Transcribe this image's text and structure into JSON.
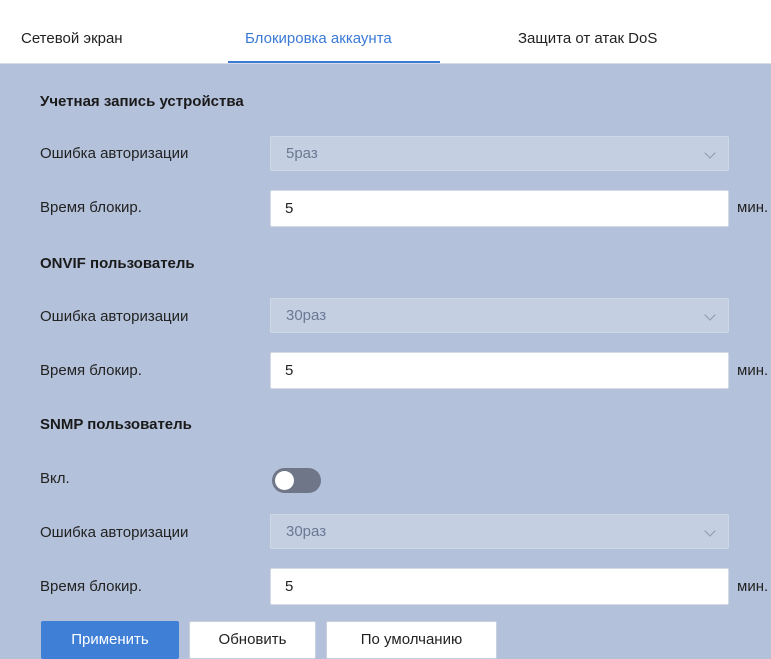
{
  "tabs": [
    {
      "label": "Сетевой экран",
      "active": false
    },
    {
      "label": "Блокировка аккаунта",
      "active": true
    },
    {
      "label": "Защита от атак DoS",
      "active": false
    }
  ],
  "device_account": {
    "title": "Учетная запись устройства",
    "auth_error_label": "Ошибка авторизации",
    "auth_error_value": "5раз",
    "lock_time_label": "Время блокир.",
    "lock_time_value": "5",
    "unit": "мин."
  },
  "onvif_user": {
    "title": "ONVIF пользователь",
    "auth_error_label": "Ошибка авторизации",
    "auth_error_value": "30раз",
    "lock_time_label": "Время блокир.",
    "lock_time_value": "5",
    "unit": "мин."
  },
  "snmp_user": {
    "title": "SNMP пользователь",
    "enable_label": "Вкл.",
    "enabled": false,
    "auth_error_label": "Ошибка авторизации",
    "auth_error_value": "30раз",
    "lock_time_label": "Время блокир.",
    "lock_time_value": "5",
    "unit": "мин."
  },
  "buttons": {
    "apply": "Применить",
    "refresh": "Обновить",
    "default": "По умолчанию"
  },
  "colors": {
    "background": "#b3c1da",
    "accent": "#3f80d6",
    "active_tab": "#3b7ad6"
  },
  "icons": {
    "dropdown": "chevron-down-icon"
  }
}
